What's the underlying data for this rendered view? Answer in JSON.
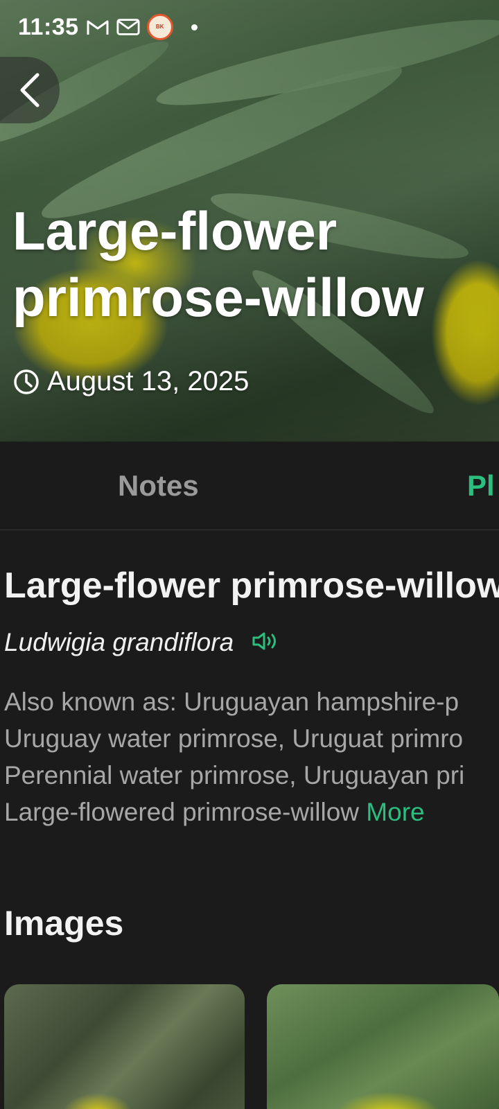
{
  "status_bar": {
    "time": "11:35",
    "icons": [
      "gmail-icon",
      "mail-outline-icon",
      "burger-king-app-icon",
      "notification-dot"
    ]
  },
  "hero": {
    "title": "Large-flower primrose-willow",
    "date": "August 13, 2025"
  },
  "tabs": [
    {
      "label": "Notes",
      "active": false
    },
    {
      "label": "Pl",
      "active": true
    }
  ],
  "plant": {
    "common_name": "Large-flower primrose-willow",
    "scientific_name": "Ludwigia grandiflora",
    "aka_lines": [
      "Also known as: Uruguayan hampshire-p",
      "Uruguay water primrose, Uruguat primro",
      "Perennial water primrose, Uruguayan pri",
      "Large-flowered primrose-willow "
    ],
    "more_label": "More"
  },
  "images_section": {
    "heading": "Images"
  },
  "colors": {
    "accent": "#2bbf7f",
    "background": "#1b1b1b",
    "muted_text": "#a7a7a7"
  }
}
